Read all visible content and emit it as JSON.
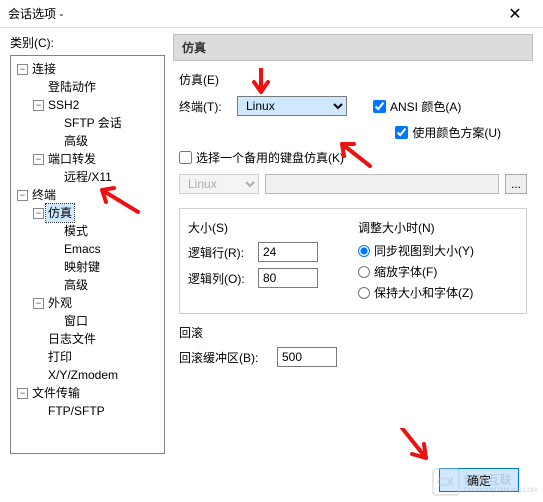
{
  "window": {
    "title": "会话选项  -",
    "close": "✕"
  },
  "left": {
    "category_label": "类别(C):",
    "tree": {
      "conn": "连接",
      "login": "登陆动作",
      "ssh2": "SSH2",
      "sftp": "SFTP 会话",
      "adv1": "高级",
      "portfwd": "端口转发",
      "remote": "远程/X11",
      "terminal": "终端",
      "emul": "仿真",
      "mode": "模式",
      "emacs": "Emacs",
      "mapkey": "映射键",
      "adv2": "高级",
      "appear": "外观",
      "window": "窗口",
      "logfile": "日志文件",
      "print": "打印",
      "xyz": "X/Y/Zmodem",
      "filetrans": "文件传输",
      "ftpsftp": "FTP/SFTP"
    }
  },
  "right": {
    "header": "仿真",
    "emul_label": "仿真(E)",
    "term_label": "终端(T):",
    "term_value": "Linux",
    "ansi_color": "ANSI 颜色(A)",
    "color_scheme": "使用颜色方案(U)",
    "alt_kb": "选择一个备用的键盘仿真(K)",
    "alt_kb_value": "Linux",
    "dots": "...",
    "size_label": "大小(S)",
    "rows_label": "逻辑行(R):",
    "rows_value": "24",
    "cols_label": "逻辑列(O):",
    "cols_value": "80",
    "resize_label": "调整大小时(N)",
    "r1": "同步视图到大小(Y)",
    "r2": "缩放字体(F)",
    "r3": "保持大小和字体(Z)",
    "scroll_label": "回滚",
    "scrollbuf_label": "回滚缓冲区(B):",
    "scrollbuf_value": "500"
  },
  "footer": {
    "ok": "确定"
  },
  "watermark": {
    "text": "创新互联",
    "sub": "CXUANXINLIANLIAN.COM"
  }
}
